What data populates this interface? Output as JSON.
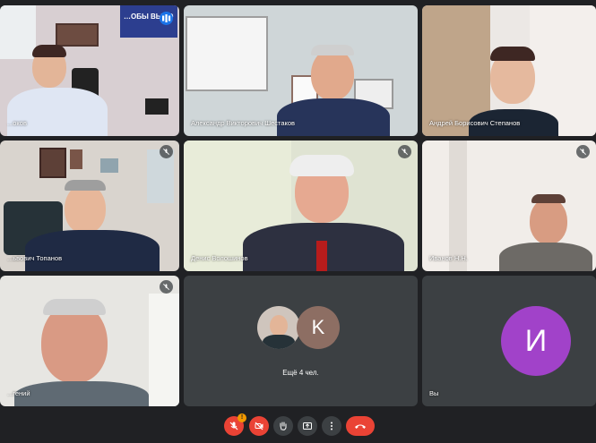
{
  "tiles": [
    {
      "name": "...оков",
      "muted": false
    },
    {
      "name": "Александр Викторович Шестаков",
      "muted": false
    },
    {
      "name": "Андрей Борисович Степанов",
      "muted": false
    },
    {
      "name": "...ьвович Топанов",
      "muted": true
    },
    {
      "name": "Денис Волошинов",
      "muted": true
    },
    {
      "name": "Иванов Н.Н.",
      "muted": true
    },
    {
      "name": "...гений",
      "muted": true
    }
  ],
  "poster_text": "…ОБЫ ВЫЛО",
  "others": {
    "avatar_letter": "K",
    "label": "Ещё 4 чел."
  },
  "self": {
    "avatar_letter": "И",
    "label": "Вы"
  },
  "toolbar": {
    "badge": "!"
  },
  "colors": {
    "bg": "#202124",
    "tile": "#3c4043",
    "end_call": "#ea4335",
    "self_avatar": "#a142c9",
    "others_avatar": "#8d6e63"
  }
}
